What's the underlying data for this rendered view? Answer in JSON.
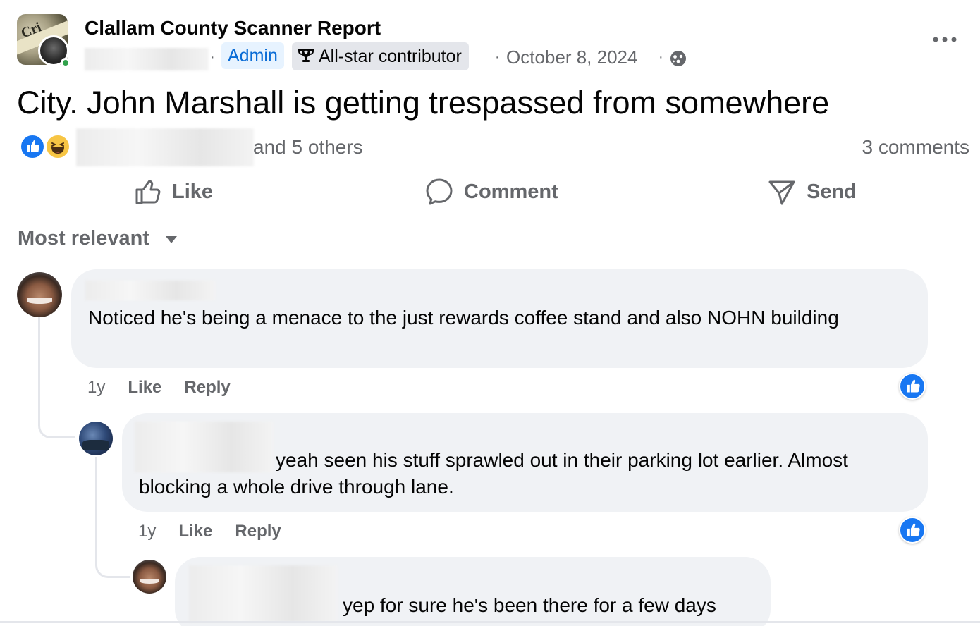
{
  "post": {
    "group_name": "Clallam County Scanner Report",
    "group_avatar_text": "Cri",
    "separator": "·",
    "admin_badge": "Admin",
    "allstar_badge": "All-star contributor",
    "date": "October 8, 2024",
    "text": "City. John Marshall is getting trespassed from somewhere",
    "reaction_summary": "and 5 others",
    "comment_count": "3 comments"
  },
  "icons": {
    "group_avatar": "group-cover-icon",
    "privacy": "public-globe-icon",
    "more": "more-options-icon",
    "allstar": "trophy-icon",
    "reactions": [
      "like-reaction-icon",
      "haha-reaction-icon"
    ],
    "like": "thumbs-up-outline-icon",
    "comment": "speech-bubble-icon",
    "send": "send-arrow-icon",
    "sort": "caret-down-icon"
  },
  "colors": {
    "accent": "#1877f2",
    "admin_text": "#0a6cd6",
    "admin_bg": "#e7f3ff",
    "secondary_text": "#65676b",
    "bubble_bg": "#f0f2f5",
    "online": "#31a24c",
    "haha": "#f7c544"
  },
  "actions": {
    "like": "Like",
    "comment": "Comment",
    "send": "Send"
  },
  "sort": {
    "label": "Most relevant"
  },
  "comments": [
    {
      "text": "Noticed he's being a menace to the just rewards coffee stand and also NOHN building",
      "time": "1y",
      "like": "Like",
      "reply": "Reply"
    },
    {
      "text": "yeah seen his stuff sprawled out in their parking lot earlier. Almost blocking a whole drive through lane.",
      "time": "1y",
      "like": "Like",
      "reply": "Reply"
    },
    {
      "text": "yep for sure he's been there for a few days"
    }
  ]
}
